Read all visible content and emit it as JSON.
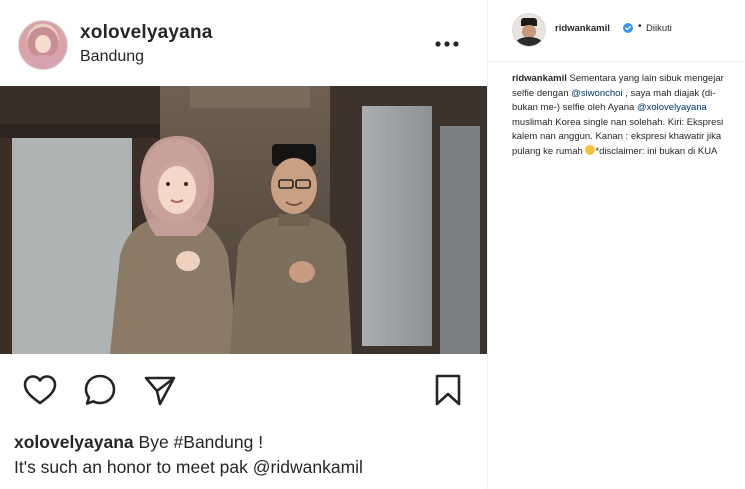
{
  "left_post": {
    "username": "xolovelyayana",
    "location": "Bandung",
    "caption": {
      "username": "xolovelyayana",
      "line1_text": " Bye ",
      "hashtag": "#Bandung",
      "line1_end": " !",
      "line2_text": "It's such an honor to meet pak ",
      "mention": "@ridwankamil"
    },
    "icons": {
      "more": "more-horizontal-icon",
      "like": "heart-icon",
      "comment": "comment-icon",
      "share": "send-icon",
      "save": "bookmark-icon"
    }
  },
  "right_panel": {
    "username": "ridwankamil",
    "verified_icon": "verified-badge-icon",
    "dot": "•",
    "follow_label": "Diikuti",
    "comment": {
      "username": "ridwankamil",
      "part1": " Sementara yang lain sibuk mengejar selfie dengan ",
      "mention1": "@siwonchoi",
      "part2": " , saya mah diajak (di- bukan me-) selfie oleh Ayana ",
      "mention2": "@xolovelyayana",
      "part3": " muslimah Korea single nan solehah. Kiri: Ekspresi kalem nan anggun. Kanan : ekspresi khawatir jika pulang ke rumah ",
      "emoji": "grimacing-emoji",
      "part4": "*disclaimer: ini bukan di KUA"
    }
  },
  "colors": {
    "text": "#262626",
    "mention": "#003569",
    "verified": "#3897f0",
    "border": "#efefef"
  }
}
